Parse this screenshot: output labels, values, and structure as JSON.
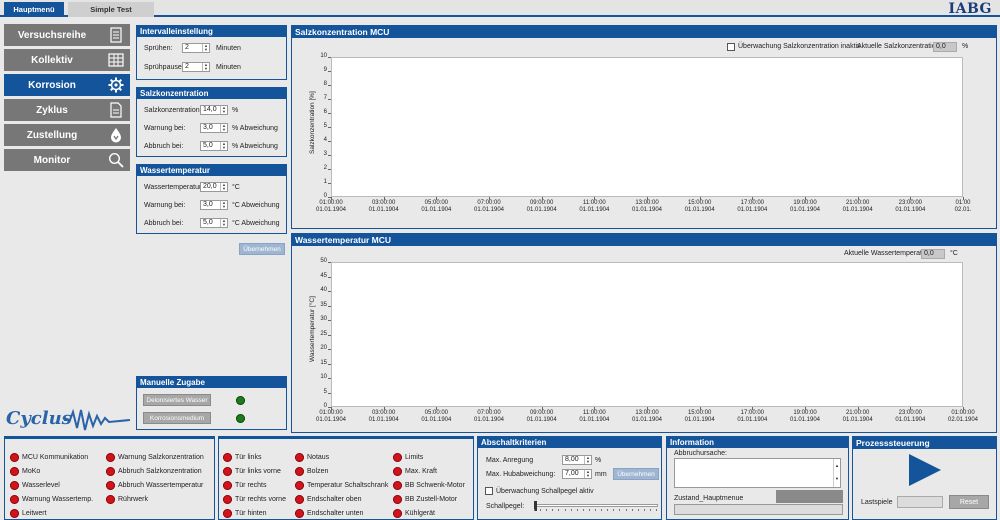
{
  "tabs": [
    {
      "label": "Hauptmenü"
    },
    {
      "label": "Simple Test"
    }
  ],
  "logo": "IABG",
  "nav": [
    {
      "label": "Versuchsreihe",
      "icon": "document-list-icon"
    },
    {
      "label": "Kollektiv",
      "icon": "grid-icon"
    },
    {
      "label": "Korrosion",
      "icon": "gear-icon"
    },
    {
      "label": "Zyklus",
      "icon": "document-icon"
    },
    {
      "label": "Zustellung",
      "icon": "drop-icon"
    },
    {
      "label": "Monitor",
      "icon": "magnifier-icon"
    }
  ],
  "brand": {
    "name": "Cyclus"
  },
  "intervall": {
    "title": "Intervalleinstellung",
    "rows": [
      {
        "label": "Sprühen:",
        "value": "2",
        "unit": "Minuten"
      },
      {
        "label": "Sprühpause:",
        "value": "2",
        "unit": "Minuten"
      }
    ]
  },
  "salz": {
    "title": "Salzkonzentration",
    "rows": [
      {
        "label": "Salzkonzentration",
        "value": "14,0",
        "unit": "%"
      },
      {
        "label": "Warnung bei:",
        "value": "3,0",
        "unit": "% Abweichung"
      },
      {
        "label": "Abbruch bei:",
        "value": "5,0",
        "unit": "% Abweichung"
      }
    ]
  },
  "wasser": {
    "title": "Wassertemperatur",
    "rows": [
      {
        "label": "Wassertemperatur",
        "value": "20,0",
        "unit": "°C"
      },
      {
        "label": "Warnung bei:",
        "value": "3,0",
        "unit": "°C Abweichung"
      },
      {
        "label": "Abbruch bei:",
        "value": "5,0",
        "unit": "°C Abweichung"
      }
    ],
    "apply": "Übernehmen"
  },
  "manual": {
    "title": "Manuelle Zugabe",
    "buttons": [
      "Deionisiertes Wasser",
      "Korrosionsmedium"
    ]
  },
  "chart1": {
    "title": "Salzkonzentration MCU",
    "checkbox": "Überwachung Salzkonzentration inaktiv",
    "readout_label": "Aktuelle Salzkonzentration:",
    "readout_value": "0,0",
    "readout_unit": "%"
  },
  "chart2": {
    "title": "Wassertemperatur MCU",
    "readout_label": "Aktuelle Wassertemperatur:",
    "readout_value": "0,0",
    "readout_unit": "°C"
  },
  "chart_data": [
    {
      "type": "line",
      "title": "Salzkonzentration MCU",
      "ylabel": "Salzkonzentration [%]",
      "xlabel": "",
      "ylim": [
        0,
        10
      ],
      "yticks": [
        "10",
        "9",
        "8",
        "7",
        "6",
        "5",
        "4",
        "3",
        "2",
        "1",
        "0"
      ],
      "xticks": [
        [
          "01:00:00",
          "01.01.1904"
        ],
        [
          "03:00:00",
          "01.01.1904"
        ],
        [
          "05:00:00",
          "01.01.1904"
        ],
        [
          "07:00:00",
          "01.01.1904"
        ],
        [
          "09:00:00",
          "01.01.1904"
        ],
        [
          "11:00:00",
          "01.01.1904"
        ],
        [
          "13:00:00",
          "01.01.1904"
        ],
        [
          "15:00:00",
          "01.01.1904"
        ],
        [
          "17:00:00",
          "01.01.1904"
        ],
        [
          "19:00:00",
          "01.01.1904"
        ],
        [
          "21:00:00",
          "01.01.1904"
        ],
        [
          "23:00:00",
          "01.01.1904"
        ],
        [
          "01:00",
          "02.01."
        ]
      ],
      "series": []
    },
    {
      "type": "line",
      "title": "Wassertemperatur MCU",
      "ylabel": "Wassertemperatur [°C]",
      "xlabel": "",
      "ylim": [
        0,
        50
      ],
      "yticks": [
        "50",
        "45",
        "40",
        "35",
        "30",
        "25",
        "20",
        "15",
        "10",
        "5",
        "0"
      ],
      "xticks": [
        [
          "01:00:00",
          "01.01.1904"
        ],
        [
          "03:00:00",
          "01.01.1904"
        ],
        [
          "05:00:00",
          "01.01.1904"
        ],
        [
          "07:00:00",
          "01.01.1904"
        ],
        [
          "09:00:00",
          "01.01.1904"
        ],
        [
          "11:00:00",
          "01.01.1904"
        ],
        [
          "13:00:00",
          "01.01.1904"
        ],
        [
          "15:00:00",
          "01.01.1904"
        ],
        [
          "17:00:00",
          "01.01.1904"
        ],
        [
          "19:00:00",
          "01.01.1904"
        ],
        [
          "21:00:00",
          "01.01.1904"
        ],
        [
          "23:00:00",
          "01.01.1904"
        ],
        [
          "01:00:00",
          "02.01.1904"
        ]
      ],
      "series": []
    }
  ],
  "status1": [
    [
      "MCU Kommunikation",
      "Warnung Salzkonzentration"
    ],
    [
      "MoKo",
      "Abbruch Salzkonzentration"
    ],
    [
      "Wasserlevel",
      "Abbruch Wassertemperatur"
    ],
    [
      "Warnung Wassertemp.",
      "Rührwerk"
    ],
    [
      "Leitwert",
      ""
    ]
  ],
  "status2": [
    [
      "Tür links",
      "Notaus",
      "Limits"
    ],
    [
      "Tür links vorne",
      "Bolzen",
      "Max. Kraft"
    ],
    [
      "Tür rechts",
      "Temperatur Schaltschrank",
      "BB Schwenk-Motor"
    ],
    [
      "Tür rechts vorne",
      "Endschalter oben",
      "BB Zustell-Motor"
    ],
    [
      "Tür hinten",
      "Endschalter unten",
      "Kühlgerät"
    ]
  ],
  "abschalt": {
    "title": "Abschaltkriterien",
    "anregung_label": "Max. Anregung",
    "anregung_value": "8,00",
    "anregung_unit": "%",
    "hub_label": "Max. Hubabweichung:",
    "hub_value": "7,00",
    "hub_unit": "mm",
    "apply": "Übernehmen",
    "check": "Überwachung Schallpegel aktiv",
    "schall_label": "Schallpegel:",
    "schall_value": 0
  },
  "info": {
    "title": "Information",
    "abbruch_label": "Abbruchursache:",
    "abbruch_value": "",
    "zustand_label": "Zustand_Hauptmenue",
    "zustand_value": ""
  },
  "prozess": {
    "title": "Prozesssteuerung",
    "lastspiele_label": "Lastspiele",
    "lastspiele_value": "",
    "reset": "Reset"
  }
}
